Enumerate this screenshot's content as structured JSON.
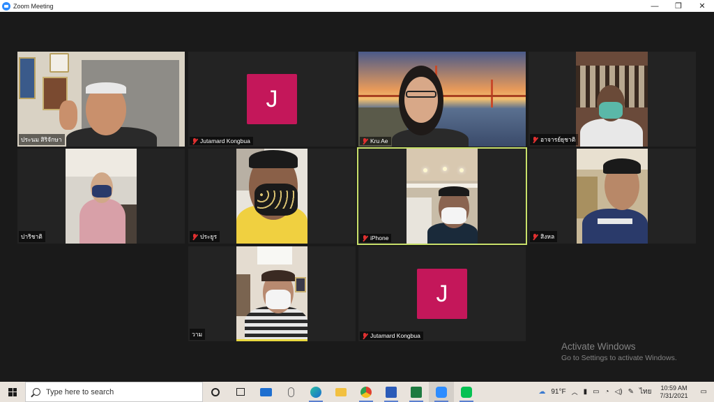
{
  "window": {
    "title": "Zoom Meeting",
    "minimize": "—",
    "restore": "❐",
    "close": "✕"
  },
  "participants": [
    {
      "name": "ประนม สิริจักษา",
      "muted": false
    },
    {
      "name": "Jutamard Kongbua",
      "muted": true,
      "initial": "J"
    },
    {
      "name": "Kru Ae",
      "muted": true
    },
    {
      "name": "อาจารย์ยุชาติ",
      "muted": true
    },
    {
      "name": "ปาริชาติ",
      "muted": false
    },
    {
      "name": "ประยูร",
      "muted": true
    },
    {
      "name": "iPhone",
      "muted": true
    },
    {
      "name": "สิงหล",
      "muted": true
    },
    {
      "name": "วาม",
      "muted": false
    },
    {
      "name": "Jutamard Kongbua",
      "muted": true,
      "initial": "J"
    }
  ],
  "watermark": {
    "line1": "Activate Windows",
    "line2": "Go to Settings to activate Windows."
  },
  "taskbar": {
    "search_placeholder": "Type here to search",
    "weather": "91°F",
    "language": "ไทย",
    "time": "10:59 AM",
    "date": "7/31/2021"
  },
  "colors": {
    "avatar": "#c4175a",
    "active_speaker": "#c8e06a",
    "zoom_blue": "#2d8cff"
  }
}
